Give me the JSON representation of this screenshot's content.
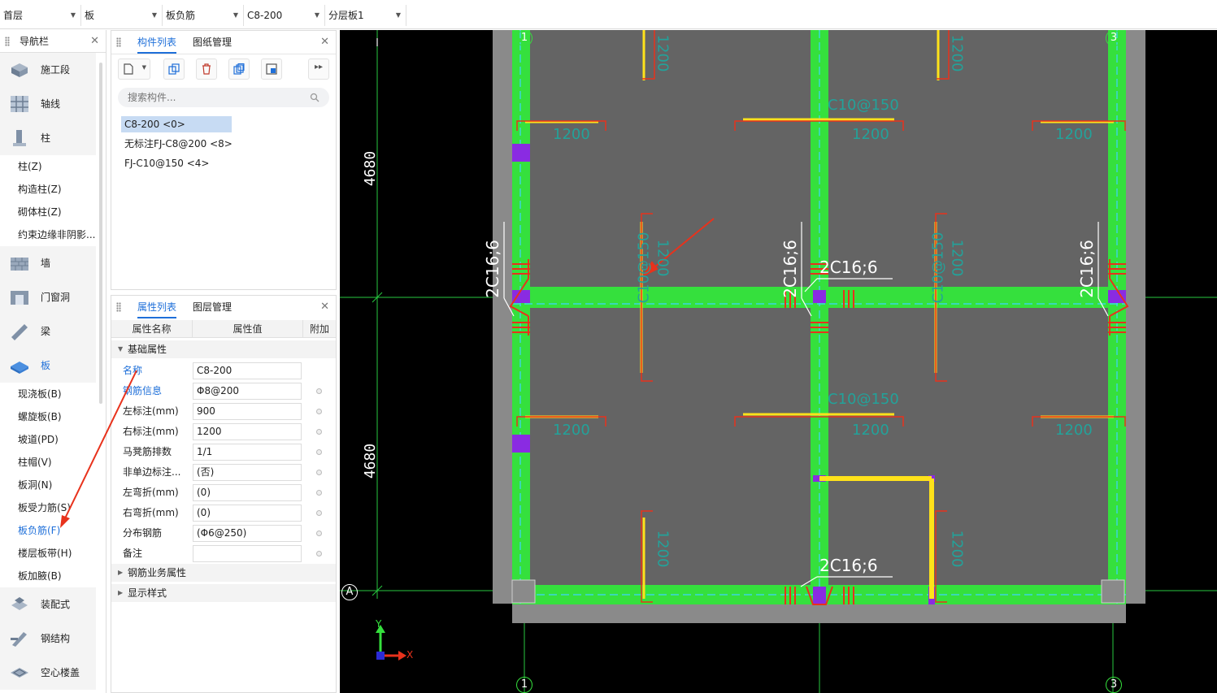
{
  "topbar": {
    "floor": "首层",
    "category": "板",
    "type": "板负筋",
    "component": "C8-200",
    "layer": "分层板1"
  },
  "nav": {
    "title": "导航栏",
    "groups": [
      {
        "label": "施工段",
        "icon": "segment-icon"
      },
      {
        "label": "轴线",
        "icon": "grid-icon"
      },
      {
        "label": "柱",
        "icon": "column-icon"
      }
    ],
    "column_items": [
      "柱(Z)",
      "构造柱(Z)",
      "砌体柱(Z)",
      "约束边缘非阴影..."
    ],
    "groups2": [
      {
        "label": "墙",
        "icon": "wall-icon"
      },
      {
        "label": "门窗洞",
        "icon": "door-icon"
      },
      {
        "label": "梁",
        "icon": "beam-icon"
      },
      {
        "label": "板",
        "icon": "slab-icon"
      }
    ],
    "slab_items": [
      "现浇板(B)",
      "螺旋板(B)",
      "坡道(PD)",
      "柱帽(V)",
      "板洞(N)",
      "板受力筋(S)",
      "板负筋(F)",
      "楼层板带(H)",
      "板加腋(B)"
    ],
    "groups3": [
      {
        "label": "装配式",
        "icon": "prefab-icon"
      },
      {
        "label": "钢结构",
        "icon": "steel-icon"
      },
      {
        "label": "空心楼盖",
        "icon": "hollow-floor-icon"
      }
    ]
  },
  "complist": {
    "tab_active": "构件列表",
    "tab_other": "图纸管理",
    "search_placeholder": "搜索构件...",
    "items": [
      "C8-200 <0>",
      "无标注FJ-C8@200 <8>",
      "FJ-C10@150 <4>"
    ]
  },
  "props": {
    "tab_active": "属性列表",
    "tab_other": "图层管理",
    "col_name": "属性名称",
    "col_value": "属性值",
    "col_extra": "附加",
    "group_basic": "基础属性",
    "rows": [
      {
        "name": "名称",
        "value": "C8-200"
      },
      {
        "name": "钢筋信息",
        "value": "Φ8@200"
      },
      {
        "name": "左标注(mm)",
        "value": "900"
      },
      {
        "name": "右标注(mm)",
        "value": "1200"
      },
      {
        "name": "马凳筋排数",
        "value": "1/1"
      },
      {
        "name": "非单边标注...",
        "value": "(否)"
      },
      {
        "name": "左弯折(mm)",
        "value": "(0)"
      },
      {
        "name": "右弯折(mm)",
        "value": "(0)"
      },
      {
        "name": "分布钢筋",
        "value": "(Φ6@250)"
      },
      {
        "name": "备注",
        "value": ""
      }
    ],
    "group_rebar": "钢筋业务属性",
    "group_display": "显示样式"
  },
  "canvas": {
    "dim_upper": "4680",
    "dim_lower": "4680",
    "axis_1": "1",
    "axis_3": "3",
    "axis_a": "A",
    "label_2c16": "2C16;6",
    "label_c10": "C10@150",
    "label_1200": "1200",
    "label_y": "Y",
    "label_x": "X"
  }
}
